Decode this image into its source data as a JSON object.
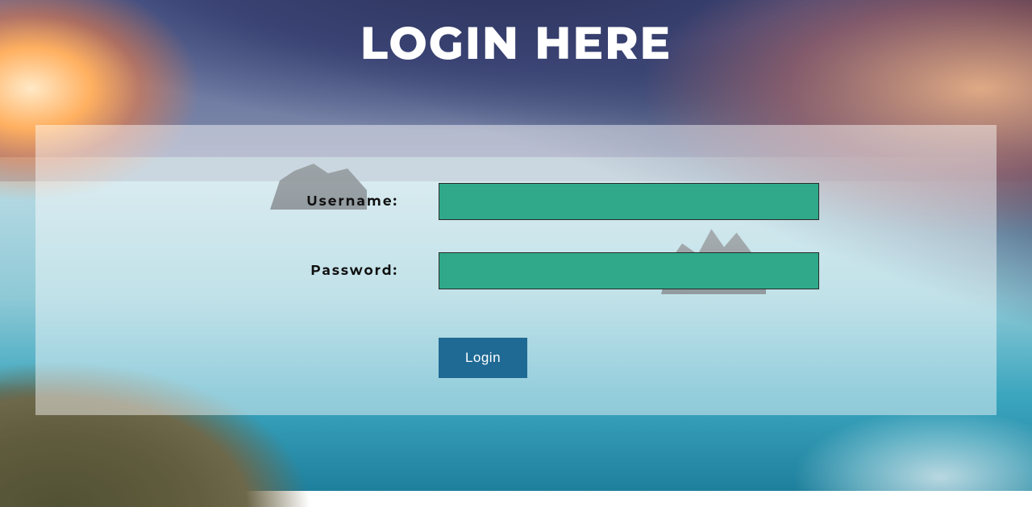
{
  "title": "LOGIN HERE",
  "form": {
    "username": {
      "label": "Username:",
      "value": ""
    },
    "password": {
      "label": "Password:",
      "value": ""
    },
    "submit_label": "Login"
  },
  "colors": {
    "input_bg": "#2fa98a",
    "button_bg": "#1f6a94",
    "panel_overlay": "rgba(255,255,255,0.45)"
  }
}
